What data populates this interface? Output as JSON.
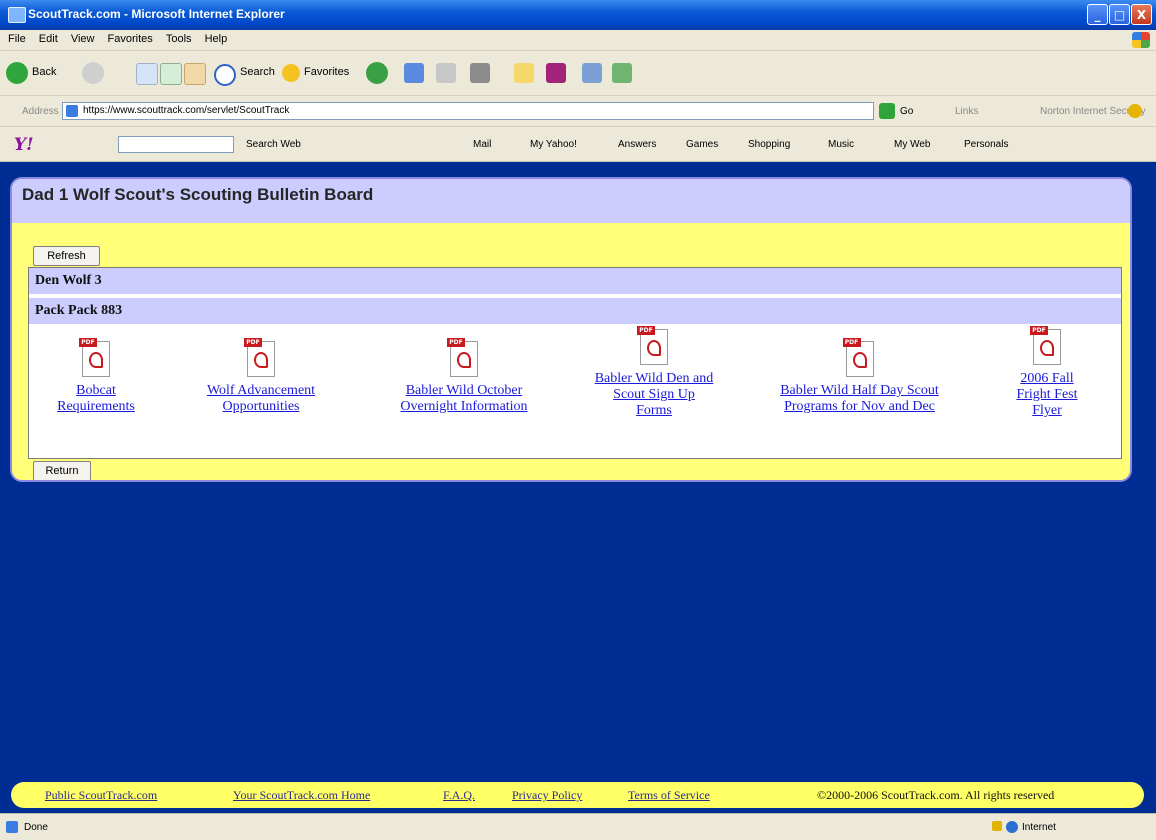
{
  "window": {
    "title": "ScoutTrack.com - Microsoft Internet Explorer",
    "minimize": "_",
    "maximize": "□",
    "close": "X"
  },
  "menu": [
    "File",
    "Edit",
    "View",
    "Favorites",
    "Tools",
    "Help"
  ],
  "toolbar": {
    "back": "Back",
    "search": "Search",
    "favorites": "Favorites"
  },
  "address": {
    "label": "Address",
    "url": "https://www.scouttrack.com/servlet/ScoutTrack",
    "go": "Go",
    "links": "Links",
    "norton": "Norton Internet Security"
  },
  "yahoo": {
    "logo": "Y!",
    "items": [
      "Search Web",
      "Mail",
      "My Yahoo!",
      "Answers",
      "Games",
      "Shopping",
      "Music",
      "My Web",
      "Personals"
    ]
  },
  "board": {
    "title": "Dad 1 Wolf Scout's Scouting Bulletin Board",
    "refresh": "Refresh",
    "return": "Return",
    "den": "Den Wolf 3",
    "pack": "Pack Pack 883",
    "docs": [
      {
        "lines": [
          "Bobcat",
          "Requirements"
        ]
      },
      {
        "lines": [
          "Wolf Advancement",
          "Opportunities"
        ]
      },
      {
        "lines": [
          "Babler Wild October",
          "Overnight Information"
        ]
      },
      {
        "lines": [
          "Babler Wild Den and",
          "Scout Sign Up",
          "Forms"
        ]
      },
      {
        "lines": [
          "Babler Wild Half Day Scout",
          "Programs for Nov and Dec"
        ]
      },
      {
        "lines": [
          "2006 Fall",
          "Fright Fest",
          "Flyer"
        ]
      }
    ]
  },
  "footer": {
    "links": [
      "Public ScoutTrack.com",
      "Your ScoutTrack.com Home",
      "F.A.Q.",
      "Privacy Policy",
      "Terms of Service"
    ],
    "copyright": "©2000-2006 ScoutTrack.com. All rights reserved"
  },
  "status": {
    "text": "Done",
    "zone": "Internet"
  },
  "colors": {
    "page_bg": "#002d94",
    "board_bg": "#ffff7a",
    "header_bg": "#ccccff",
    "link": "#1a1adb"
  }
}
